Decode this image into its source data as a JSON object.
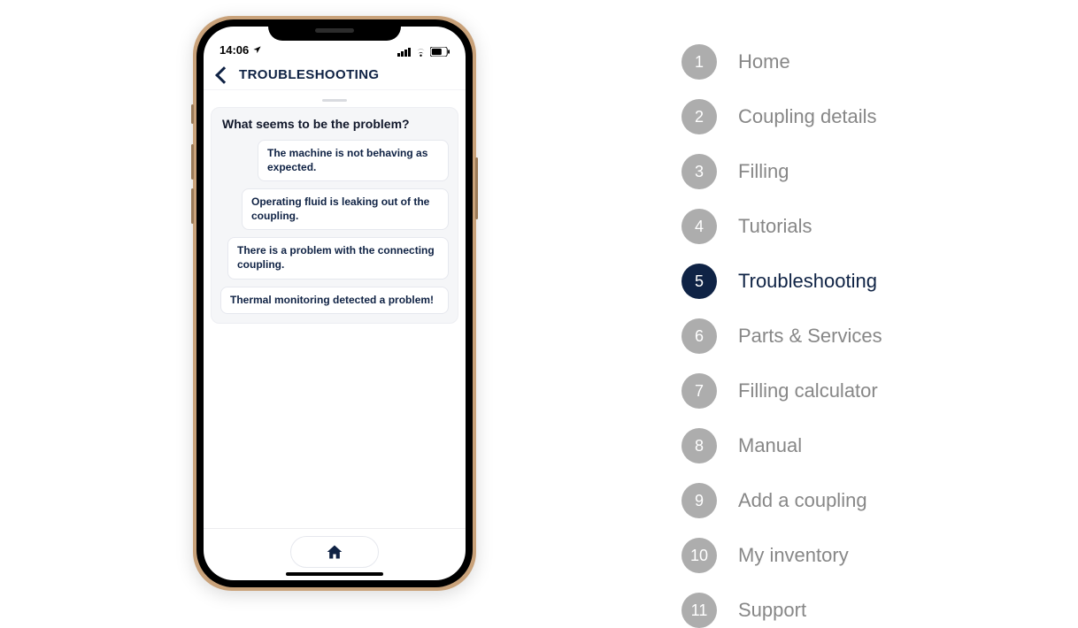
{
  "colors": {
    "brand_dark": "#0f2244",
    "badge_inactive": "#adadad",
    "label_inactive": "#878787"
  },
  "status": {
    "time": "14:06",
    "nav_icon_name": "location-arrow-icon"
  },
  "nav": {
    "title": "TROUBLESHOOTING",
    "back_icon_name": "chevron-left-icon"
  },
  "card": {
    "title": "What seems to be the problem?",
    "options": [
      "The machine is not behaving as expected.",
      "Operating fluid is leaking out of the coupling.",
      "There is a problem with the connecting coupling.",
      "Thermal monitoring detected a problem!"
    ]
  },
  "bottom": {
    "home_icon_name": "home-icon"
  },
  "legend": {
    "active_index": 4,
    "items": [
      {
        "num": "1",
        "label": "Home"
      },
      {
        "num": "2",
        "label": "Coupling details"
      },
      {
        "num": "3",
        "label": "Filling"
      },
      {
        "num": "4",
        "label": "Tutorials"
      },
      {
        "num": "5",
        "label": "Troubleshooting"
      },
      {
        "num": "6",
        "label": "Parts & Services"
      },
      {
        "num": "7",
        "label": "Filling calculator"
      },
      {
        "num": "8",
        "label": "Manual"
      },
      {
        "num": "9",
        "label": "Add a coupling"
      },
      {
        "num": "10",
        "label": "My inventory"
      },
      {
        "num": "11",
        "label": "Support"
      }
    ]
  }
}
